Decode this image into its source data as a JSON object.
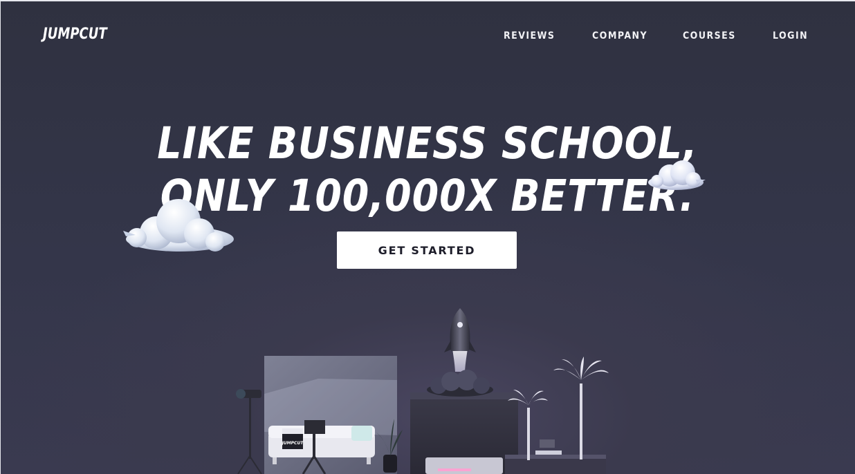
{
  "brand": {
    "logo": "JUMPCUT"
  },
  "nav": {
    "items": [
      {
        "label": "REVIEWS"
      },
      {
        "label": "COMPANY"
      },
      {
        "label": "COURSES"
      },
      {
        "label": "LOGIN"
      }
    ]
  },
  "hero": {
    "headline_line1": "LIKE BUSINESS SCHOOL,",
    "headline_line2": "ONLY 100,000X BETTER.",
    "cta_label": "GET STARTED",
    "clapper_text": "JUMPCUT"
  },
  "colors": {
    "background": "#34364a",
    "text": "#ffffff",
    "button_bg": "#ffffff",
    "button_text": "#1d1d2a"
  }
}
